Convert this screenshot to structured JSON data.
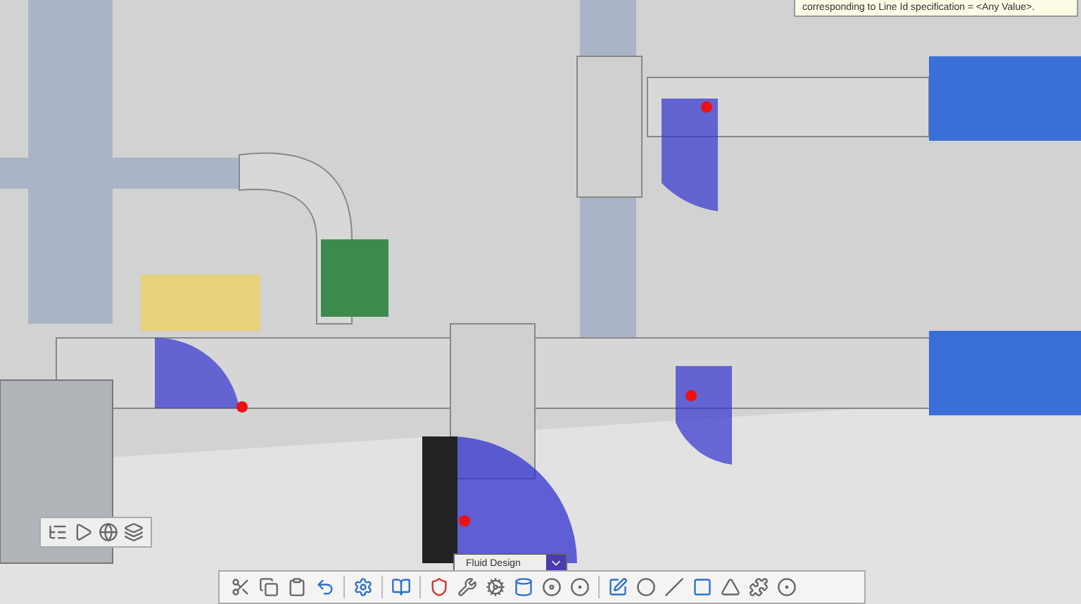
{
  "tooltip": {
    "text": "corresponding to Line Id specification = <Any Value>."
  },
  "workbench": {
    "label": "Fluid Design"
  }
}
